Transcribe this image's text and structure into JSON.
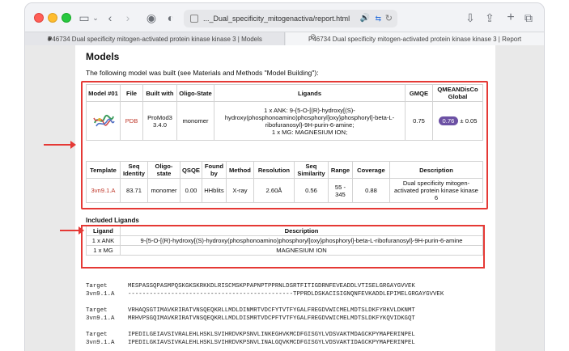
{
  "browser": {
    "url": "..._Dual_specificity_mitogenactiva/report.html",
    "tabs": [
      {
        "label": "P46734 Dual specificity mitogen-activated protein kinase kinase 3 | Models"
      },
      {
        "label": "P46734 Dual specificity mitogen-activated protein kinase kinase 3 | Report"
      }
    ]
  },
  "page": {
    "title": "Models",
    "intro": "The following model was built (see Materials and Methods \"Model Building\"):"
  },
  "model_table": {
    "headers": [
      "Model #01",
      "File",
      "Built with",
      "Oligo-State",
      "Ligands",
      "GMQE",
      "QMEANDisCo Global"
    ],
    "file": "PDB",
    "built_with": "ProMod3 3.4.0",
    "oligo_state": "monomer",
    "ligands_line1": "1 x ANK: 9-{5-O-[(R)-hydroxy[(S)-hydroxy(phosphonoamino)phosphoryl]oxy}phosphoryl]-beta-L-ribofuranosyl}-9H-purin-6-amine;",
    "ligands_line2": "1 x MG: MAGNESIUM ION;",
    "gmqe": "0.75",
    "qmean": "0.76",
    "qmean_err": "± 0.05"
  },
  "template_table": {
    "headers": [
      "Template",
      "Seq Identity",
      "Oligo-state",
      "QSQE",
      "Found by",
      "Method",
      "Resolution",
      "Seq Similarity",
      "Range",
      "Coverage",
      "Description"
    ],
    "row": [
      "3vn9.1.A",
      "83.71",
      "monomer",
      "0.00",
      "HHblits",
      "X-ray",
      "2.60Å",
      "0.56",
      "55 - 345",
      "0.88",
      "Dual specificity mitogen-activated protein kinase kinase 6"
    ]
  },
  "included_ligands": {
    "title": "Included Ligands",
    "headers": [
      "Ligand",
      "Description"
    ],
    "rows": [
      [
        "1 x ANK",
        "9-{5-O-[(R)-hydroxy[(S)-hydroxy(phosphonoamino)phosphoryl]oxy}phosphoryl]-beta-L-ribofuranosyl}-9H-purin-6-amine"
      ],
      [
        "1 x MG",
        "MAGNESIUM ION"
      ]
    ]
  },
  "alignment": [
    {
      "label": "Target",
      "seq": "MESPASSQPASMPQSKGKSKRKKDLRISCMSKPPAPNPTPPRNLDSRTFITIGDRNFEVEADDLVTISELGRGAYGVVEK"
    },
    {
      "label": "3vn9.1.A",
      "seq": "----------------------------------------------TPPRDLDSKACISIGNQNFEVKADDLEPIMELGRGAYGVVEK"
    },
    {
      "label": "Target",
      "seq": "VRHAQSGTIMAVKRIRATVNSQEQKRLLMDLDINMRTVDCFYTVTFYGALFREGDVWICMELMDTSLDKFYRKVLDKNMT"
    },
    {
      "label": "3vn9.1.A",
      "seq": "MRHVPSGQIMAVKRIRATVNSQEQKRLLMDLDISMRTVDCPFTVTFYGALFREGDVWICMELMDTSLDKFYKQVIDKGQT"
    },
    {
      "label": "Target",
      "seq": "IPEDILGEIAVSIVRALEHLHSKLSVIHRDVKPSNVLINKEGHVKMCDFGISGYLVDSVAKTMDAGCKPYMAPERINPEL"
    },
    {
      "label": "3vn9.1.A",
      "seq": "IPEDILGKIAVSIVKALEHLHSKLSVIHRDVKPSNVLINALGQVKMCDFGISGYLVDSVAKTIDAGCKPYMAPERINPEL"
    }
  ]
}
